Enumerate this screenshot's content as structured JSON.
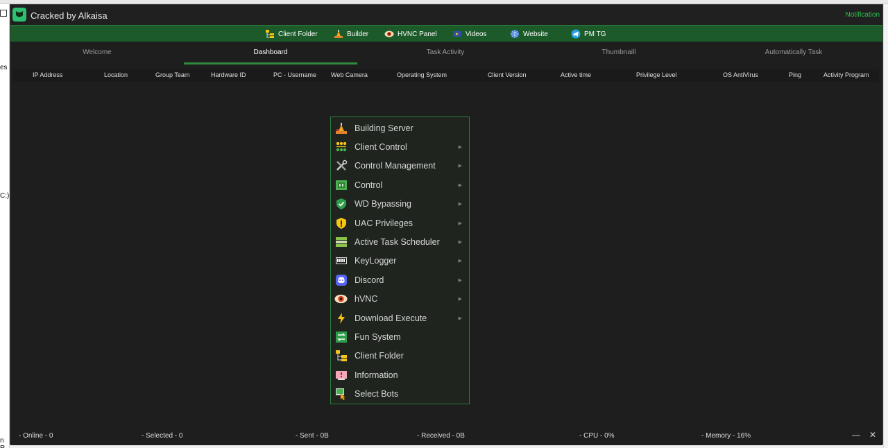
{
  "desktop": {
    "frag_es": "es",
    "frag_c": "C:)",
    "frag_nr": "n R"
  },
  "window": {
    "title": "Cracked by Alkaisa",
    "notification": "Notification"
  },
  "toolbar": [
    {
      "label": "Client Folder",
      "icon": "folder-tree-icon"
    },
    {
      "label": "Builder",
      "icon": "builder-icon"
    },
    {
      "label": "HVNC Panel",
      "icon": "eye-icon"
    },
    {
      "label": "Videos",
      "icon": "video-icon"
    },
    {
      "label": "Website",
      "icon": "globe-icon"
    },
    {
      "label": "PM TG",
      "icon": "telegram-icon"
    }
  ],
  "tabs": [
    {
      "label": "Welcome"
    },
    {
      "label": "Dashboard",
      "active": true
    },
    {
      "label": "Task Activity"
    },
    {
      "label": "Thumbnaill"
    },
    {
      "label": "Automatically Task"
    }
  ],
  "columns": [
    "IP Address",
    "Location",
    "Group Team",
    "Hardware ID",
    "PC - Username",
    "Web Camera",
    "Operating System",
    "Client Version",
    "Active time",
    "Privilege Level",
    "OS AntiVirus",
    "Ping",
    "Activity Program"
  ],
  "context_menu": [
    {
      "label": "Building Server",
      "icon": "builder-icon",
      "submenu": false
    },
    {
      "label": "Client Control",
      "icon": "network-icon",
      "submenu": true
    },
    {
      "label": "Control Management",
      "icon": "tools-icon",
      "submenu": true
    },
    {
      "label": "Control",
      "icon": "chip-icon",
      "submenu": true
    },
    {
      "label": "WD Bypassing",
      "icon": "shield-check-icon",
      "submenu": true
    },
    {
      "label": "UAC Privileges",
      "icon": "shield-warning-icon",
      "submenu": true
    },
    {
      "label": "Active Task Scheduler",
      "icon": "list-icon",
      "submenu": true
    },
    {
      "label": "KeyLogger",
      "icon": "keyboard-icon",
      "submenu": true
    },
    {
      "label": "Discord",
      "icon": "discord-icon",
      "submenu": true
    },
    {
      "label": "hVNC",
      "icon": "eye-icon",
      "submenu": true
    },
    {
      "label": "Download Execute",
      "icon": "lightning-icon",
      "submenu": true
    },
    {
      "label": "Fun System",
      "icon": "fun-icon",
      "submenu": false
    },
    {
      "label": "Client Folder",
      "icon": "folder-tree-icon",
      "submenu": false
    },
    {
      "label": "Information",
      "icon": "info-icon",
      "submenu": false
    },
    {
      "label": "Select Bots",
      "icon": "pointer-icon",
      "submenu": false
    }
  ],
  "status": {
    "online": "- Online - 0",
    "selected": "- Selected - 0",
    "sent": "- Sent - 0B",
    "received": "- Received -  0B",
    "cpu": "- CPU - 0%",
    "memory": "- Memory - 16%",
    "minimize": "—",
    "close": "✕"
  },
  "colors": {
    "accent": "#2e8b40",
    "toolbar": "#1c5a2a",
    "notification": "#27c24c"
  }
}
